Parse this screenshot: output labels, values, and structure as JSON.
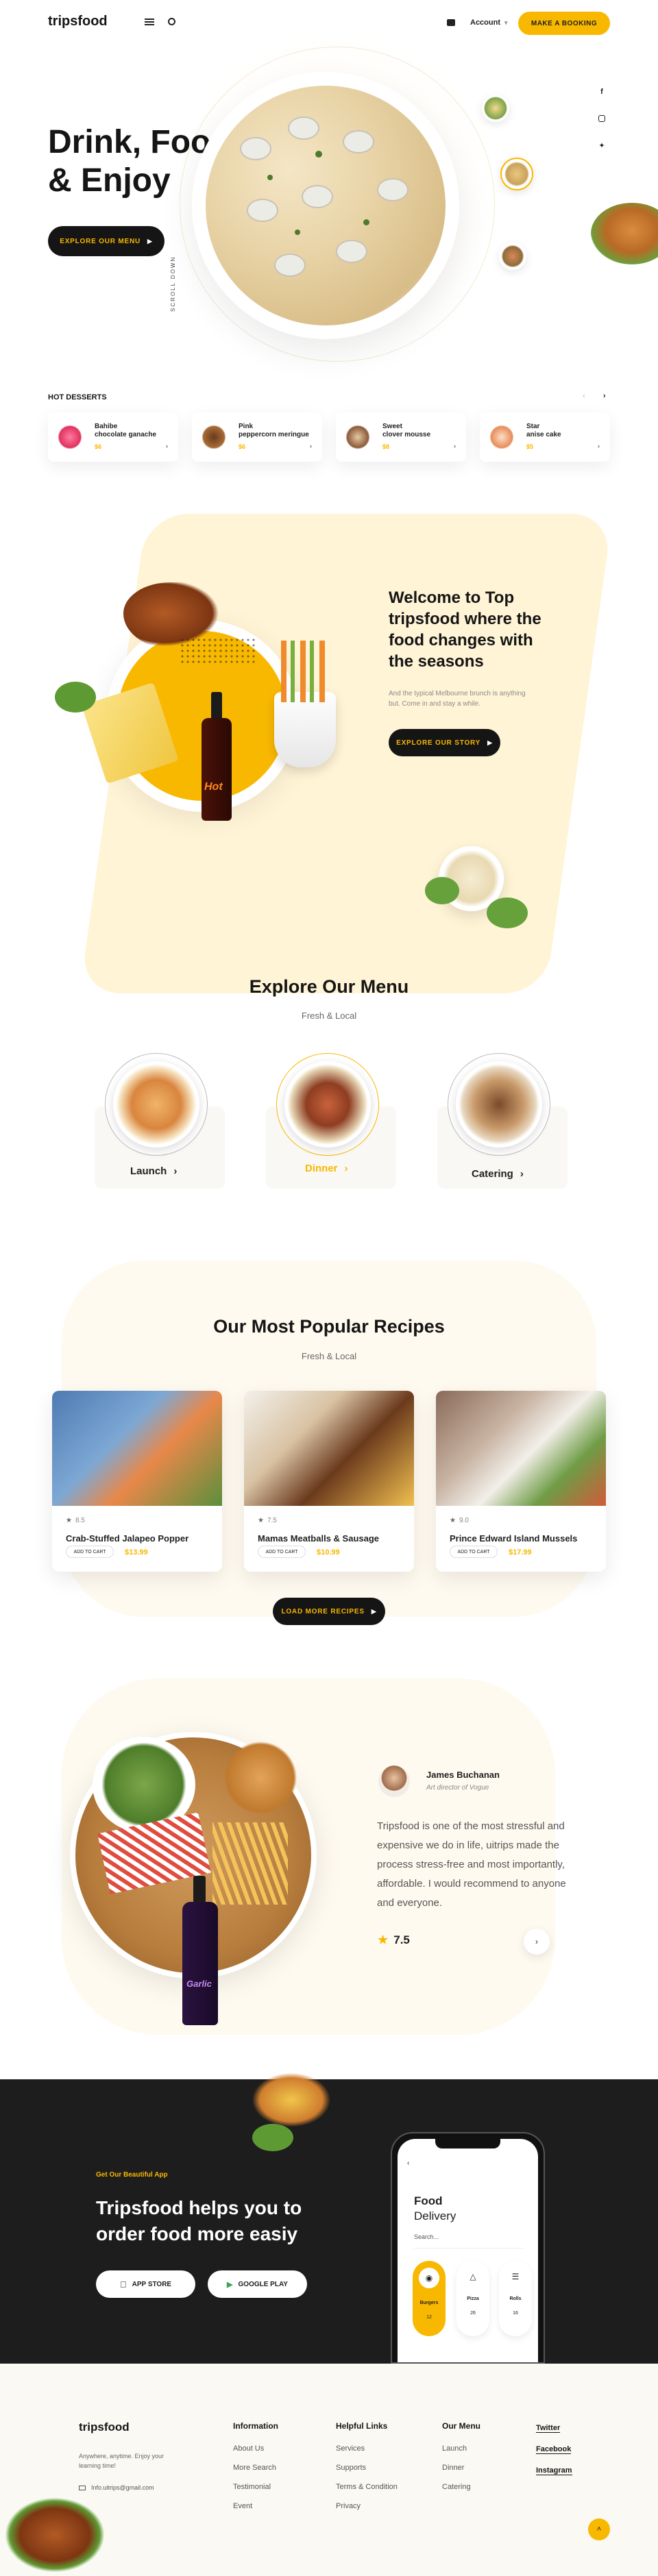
{
  "header": {
    "logo": "tripsfood",
    "account_label": "Account",
    "booking_button": "MAKE A BOOKING"
  },
  "hero": {
    "title_line1": "Drink, Food",
    "title_line2": "& Enjoy",
    "explore_button": "EXPLORE OUR MENU",
    "scroll_label": "SCROLL DOWN",
    "social_icons": [
      "facebook-icon",
      "instagram-icon",
      "twitter-icon"
    ]
  },
  "hot_desserts": {
    "title": "HOT DESSERTS",
    "items": [
      {
        "name_line1": "Bahibe",
        "name_line2": "chocolate ganache",
        "price": "$6"
      },
      {
        "name_line1": "Pink",
        "name_line2": "peppercorn meringue",
        "price": "$6"
      },
      {
        "name_line1": "Sweet",
        "name_line2": "clover mousse",
        "price": "$8"
      },
      {
        "name_line1": "Star",
        "name_line2": "anise cake",
        "price": "$5"
      }
    ]
  },
  "welcome": {
    "title_line1": "Welcome to Top",
    "title_line2": "tripsfood where the",
    "title_line3": "food changes with",
    "title_line4": "the seasons",
    "body_line1": "And the typical Melbourne brunch is anything",
    "body_line2": "but. Come in and stay a while.",
    "button": "EXPLORE OUR STORY",
    "sauce_label": "Hot"
  },
  "menu": {
    "title": "Explore Our Menu",
    "subtitle": "Fresh & Local",
    "items": [
      {
        "label": "Launch"
      },
      {
        "label": "Dinner"
      },
      {
        "label": "Catering"
      }
    ],
    "active_color": "#f9b800"
  },
  "recipes": {
    "title": "Our Most Popular Recipes",
    "subtitle": "Fresh & Local",
    "cards": [
      {
        "rating": "8.5",
        "name": "Crab-Stuffed Jalapeo Popper",
        "add_label": "ADD TO CART",
        "price": "$13.99"
      },
      {
        "rating": "7.5",
        "name": "Mamas Meatballs & Sausage",
        "add_label": "ADD TO CART",
        "price": "$10.99"
      },
      {
        "rating": "9.0",
        "name": "Prince Edward Island Mussels",
        "add_label": "ADD TO CART",
        "price": "$17.99"
      }
    ],
    "load_more": "LOAD MORE RECIPES"
  },
  "testimonial": {
    "name": "James Buchanan",
    "role": "Art director of Vogue",
    "quote_line1": "Tripsfood is one of the most stressful and",
    "quote_line2": "expensive we do in life, uitrips made the",
    "quote_line3": "process stress-free and most importantly,",
    "quote_line4": "affordable. I would recommend to anyone",
    "quote_line5": "and everyone.",
    "rating": "7.5",
    "bottle_label": "Garlic"
  },
  "app": {
    "kicker": "Get Our Beautiful App",
    "title_line1": "Tripsfood helps you to",
    "title_line2": "order food more easiy",
    "app_store": "APP STORE",
    "google_play": "GOOGLE PLAY",
    "phone": {
      "title_line1": "Food",
      "title_line2": "Delivery",
      "search_placeholder": "Search...",
      "categories": [
        {
          "label": "Burgers",
          "count": "12"
        },
        {
          "label": "Pizza",
          "count": "26"
        },
        {
          "label": "Rolls",
          "count": "16"
        }
      ]
    }
  },
  "footer": {
    "logo": "tripsfood",
    "tagline_line1": "Anywhere, anytime. Enjoy your",
    "tagline_line2": "learning time!",
    "email": "Info.uitrips@gmail.com",
    "columns": [
      {
        "title": "Information",
        "links": [
          "About Us",
          "More Search",
          "Testimonial",
          "Event"
        ]
      },
      {
        "title": "Helpful Links",
        "links": [
          "Services",
          "Supports",
          "Terms & Condition",
          "Privacy"
        ]
      },
      {
        "title": "Our Menu",
        "links": [
          "Launch",
          "Dinner",
          "Catering"
        ]
      }
    ],
    "social": [
      "Twitter",
      "Facebook",
      "Instagram"
    ]
  }
}
